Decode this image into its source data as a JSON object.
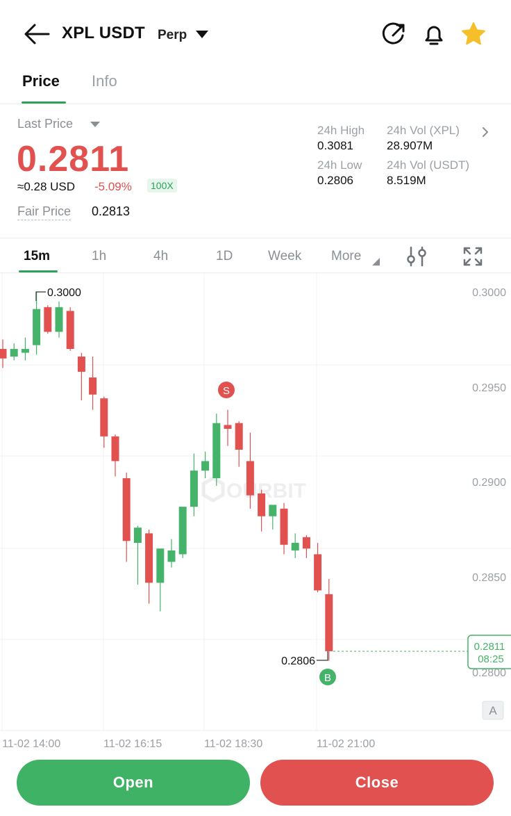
{
  "header": {
    "pair": "XPL USDT",
    "contract_type": "Perp",
    "icons": [
      "back-arrow-icon",
      "share-icon",
      "bell-icon",
      "star-icon"
    ]
  },
  "tabs": [
    {
      "label": "Price",
      "active": true
    },
    {
      "label": "Info",
      "active": false
    }
  ],
  "price": {
    "last_price_label": "Last Price",
    "last_price": "0.2811",
    "usd_equiv": "≈0.28 USD",
    "change_pct": "-5.09%",
    "leverage": "100X",
    "fair_price_label": "Fair Price",
    "fair_price": "0.2813"
  },
  "stats": {
    "high_label": "24h High",
    "high": "0.3081",
    "low_label": "24h Low",
    "low": "0.2806",
    "vol_xpl_label": "24h Vol (XPL)",
    "vol_xpl": "28.907M",
    "vol_usdt_label": "24h Vol (USDT)",
    "vol_usdt": "8.519M"
  },
  "timeframes": [
    {
      "label": "15m",
      "active": true
    },
    {
      "label": "1h",
      "active": false
    },
    {
      "label": "4h",
      "active": false
    },
    {
      "label": "1D",
      "active": false
    },
    {
      "label": "Week",
      "active": false
    },
    {
      "label": "More",
      "active": false
    }
  ],
  "colors": {
    "up": "#45b369",
    "down": "#e0514f",
    "accent": "#2ea05a"
  },
  "chart_data": {
    "type": "candlestick",
    "watermark": "OURBIT",
    "y_ticks": [
      "0.3000",
      "0.2950",
      "0.2900",
      "0.2850",
      "0.2800"
    ],
    "x_ticks": [
      "11-02 14:00",
      "11-02 16:15",
      "11-02 18:30",
      "11-02 21:00"
    ],
    "ylim": [
      0.2775,
      0.3
    ],
    "high_marker": "0.3000",
    "low_marker": "0.2806",
    "current_price": "0.2811",
    "countdown": "08:25",
    "markers": [
      {
        "label": "S",
        "type": "sell",
        "candle_index": 20
      },
      {
        "label": "B",
        "type": "buy",
        "candle_index": 29
      }
    ],
    "scale_mode_label": "A",
    "candles": [
      {
        "o": 0.297,
        "h": 0.2975,
        "l": 0.296,
        "c": 0.2965
      },
      {
        "o": 0.2966,
        "h": 0.2973,
        "l": 0.2964,
        "c": 0.297
      },
      {
        "o": 0.2968,
        "h": 0.2976,
        "l": 0.2964,
        "c": 0.297
      },
      {
        "o": 0.2972,
        "h": 0.3,
        "l": 0.2967,
        "c": 0.2991
      },
      {
        "o": 0.2992,
        "h": 0.2993,
        "l": 0.2978,
        "c": 0.2979
      },
      {
        "o": 0.2979,
        "h": 0.2995,
        "l": 0.2976,
        "c": 0.2992
      },
      {
        "o": 0.299,
        "h": 0.2992,
        "l": 0.2969,
        "c": 0.297
      },
      {
        "o": 0.2966,
        "h": 0.2968,
        "l": 0.2943,
        "c": 0.2958
      },
      {
        "o": 0.2955,
        "h": 0.2966,
        "l": 0.2938,
        "c": 0.2946
      },
      {
        "o": 0.2944,
        "h": 0.2945,
        "l": 0.2918,
        "c": 0.2924
      },
      {
        "o": 0.2924,
        "h": 0.2925,
        "l": 0.2903,
        "c": 0.2911
      },
      {
        "o": 0.2902,
        "h": 0.2905,
        "l": 0.2858,
        "c": 0.2869
      },
      {
        "o": 0.2868,
        "h": 0.2877,
        "l": 0.2846,
        "c": 0.2876
      },
      {
        "o": 0.2873,
        "h": 0.2875,
        "l": 0.2836,
        "c": 0.2847
      },
      {
        "o": 0.2847,
        "h": 0.2852,
        "l": 0.2832,
        "c": 0.2865
      },
      {
        "o": 0.2858,
        "h": 0.287,
        "l": 0.2855,
        "c": 0.2864
      },
      {
        "o": 0.2862,
        "h": 0.2887,
        "l": 0.286,
        "c": 0.2887
      },
      {
        "o": 0.2887,
        "h": 0.2915,
        "l": 0.2882,
        "c": 0.2906
      },
      {
        "o": 0.2906,
        "h": 0.2916,
        "l": 0.2902,
        "c": 0.2911
      },
      {
        "o": 0.2902,
        "h": 0.2936,
        "l": 0.2898,
        "c": 0.2931
      },
      {
        "o": 0.293,
        "h": 0.2938,
        "l": 0.2919,
        "c": 0.2928
      },
      {
        "o": 0.2931,
        "h": 0.2932,
        "l": 0.2908,
        "c": 0.2917
      },
      {
        "o": 0.2911,
        "h": 0.2926,
        "l": 0.2886,
        "c": 0.2893
      },
      {
        "o": 0.2894,
        "h": 0.2896,
        "l": 0.2874,
        "c": 0.2882
      },
      {
        "o": 0.2882,
        "h": 0.2885,
        "l": 0.2875,
        "c": 0.2888
      },
      {
        "o": 0.2886,
        "h": 0.2889,
        "l": 0.2862,
        "c": 0.2867
      },
      {
        "o": 0.2864,
        "h": 0.2873,
        "l": 0.286,
        "c": 0.2868
      },
      {
        "o": 0.2871,
        "h": 0.2872,
        "l": 0.286,
        "c": 0.2865
      },
      {
        "o": 0.2862,
        "h": 0.2868,
        "l": 0.2842,
        "c": 0.2843
      },
      {
        "o": 0.2841,
        "h": 0.2849,
        "l": 0.2806,
        "c": 0.2811
      }
    ]
  },
  "actions": {
    "open_label": "Open",
    "close_label": "Close"
  }
}
